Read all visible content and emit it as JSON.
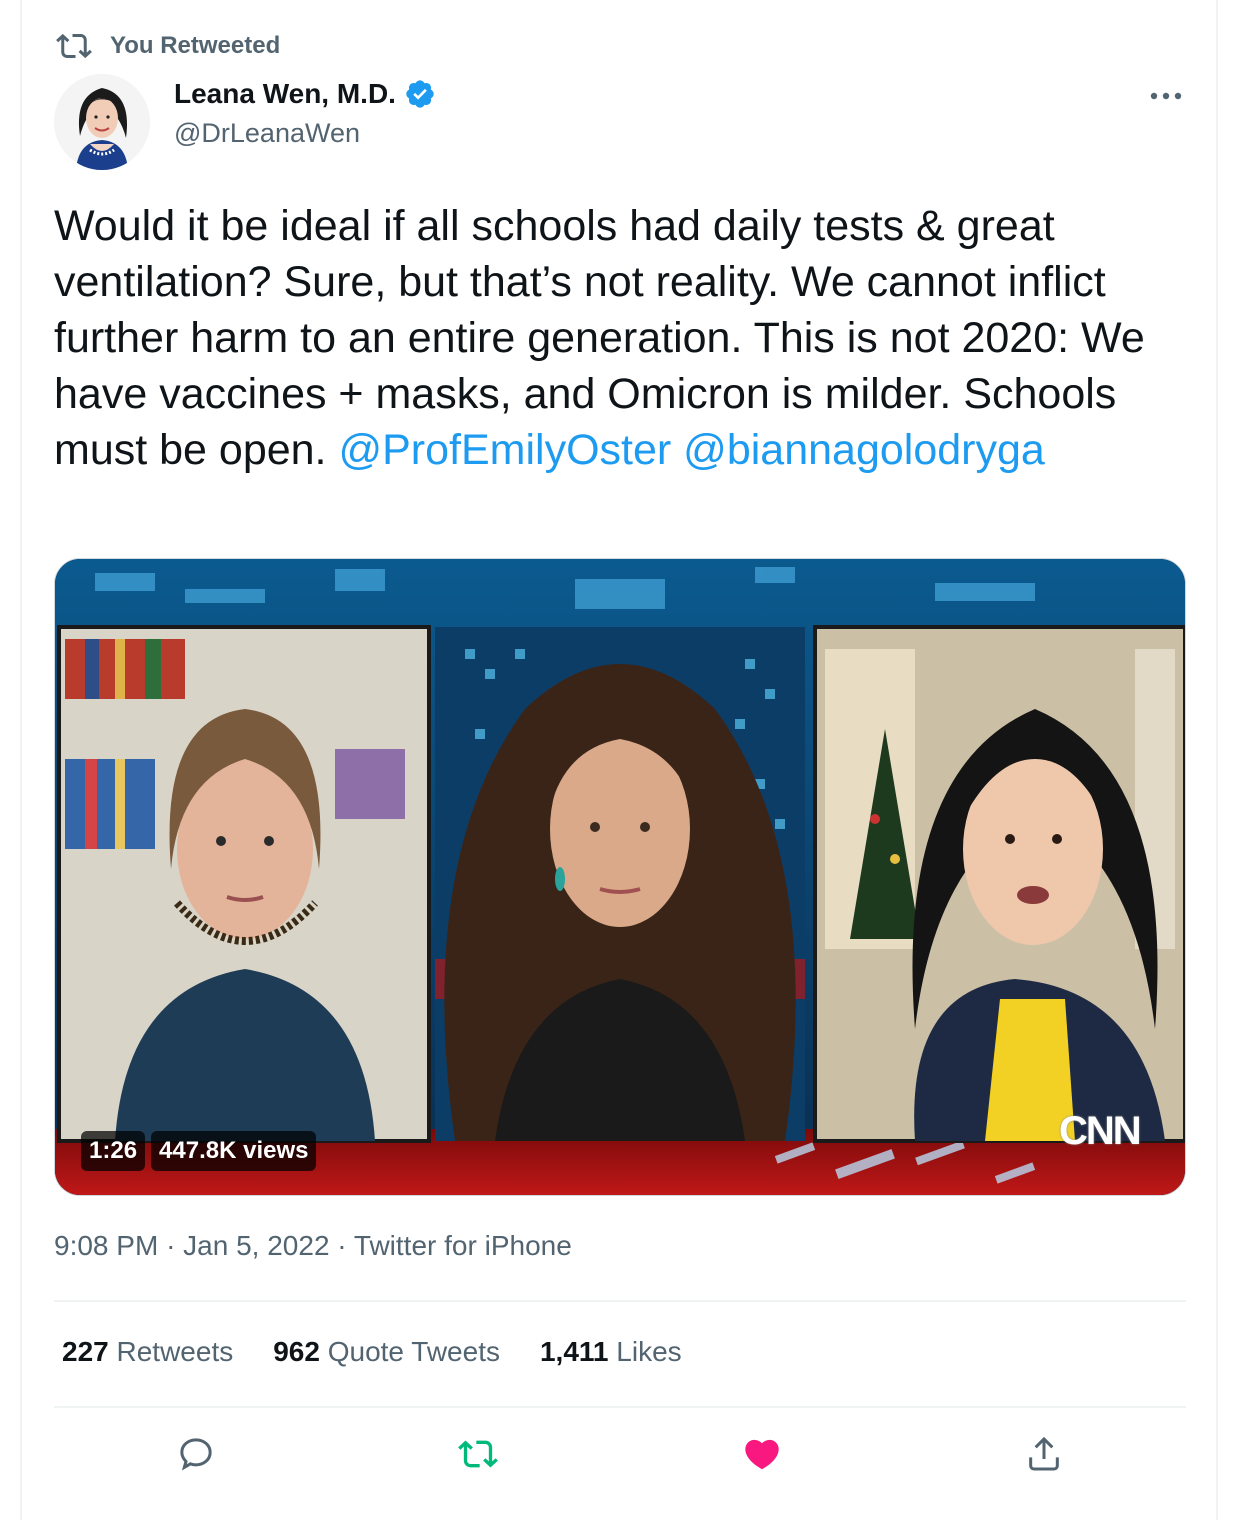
{
  "retweet_banner": {
    "text": "You Retweeted",
    "icon": "retweet-icon"
  },
  "author": {
    "name": "Leana Wen, M.D.",
    "handle": "@DrLeanaWen",
    "verified": true,
    "verified_color": "#1d9bf0"
  },
  "tweet": {
    "text": "Would it be ideal if all schools had daily tests & great ventilation? Sure, but that’s not reality. We cannot inflict further harm to an entire generation. This is not 2020: We have vaccines + masks, and Omicron is milder. Schools must be open. ",
    "mentions": [
      "@ProfEmilyOster",
      "@biannagolodryga"
    ]
  },
  "media": {
    "type": "video",
    "duration": "1:26",
    "views": "447.8K views",
    "network_logo": "CNN"
  },
  "meta": {
    "time": "9:08 PM",
    "separator": "·",
    "date": "Jan 5, 2022",
    "source": "Twitter for iPhone"
  },
  "stats": {
    "retweets_count": "227",
    "retweets_label": "Retweets",
    "quotes_count": "962",
    "quotes_label": "Quote Tweets",
    "likes_count": "1,411",
    "likes_label": "Likes"
  },
  "actions": {
    "reply_icon": "reply-icon",
    "retweet_icon": "retweet-icon",
    "like_icon": "heart-icon",
    "share_icon": "share-icon",
    "retweet_active_color": "#00ba7c",
    "like_active_color": "#f91880"
  },
  "colors": {
    "link": "#1d9bf0",
    "secondary_text": "#536471",
    "primary_text": "#0f1419"
  }
}
